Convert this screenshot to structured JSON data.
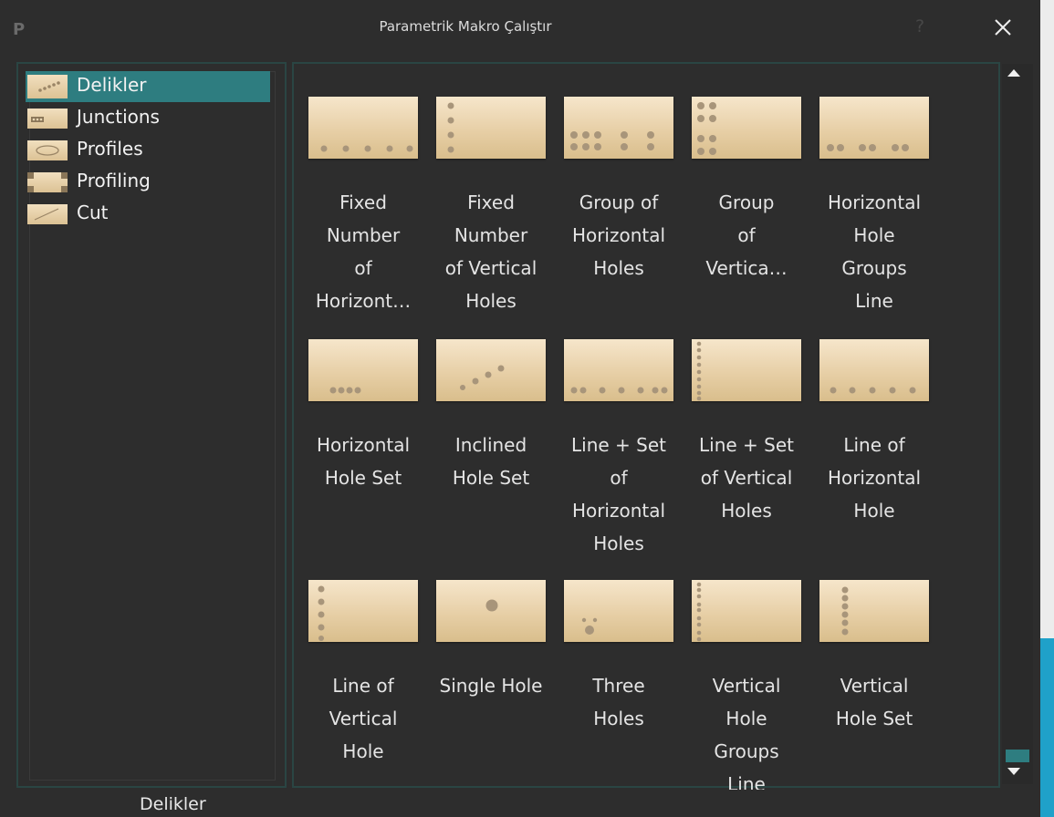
{
  "window": {
    "title": "Parametrik Makro Çalıştır",
    "app_icon": "P",
    "help_label": "?",
    "close_icon": "close-icon"
  },
  "categories": [
    {
      "label": "Delikler",
      "icon": "holes-thumbnail",
      "selected": true
    },
    {
      "label": "Junctions",
      "icon": "junctions-thumbnail",
      "selected": false
    },
    {
      "label": "Profiles",
      "icon": "profiles-thumbnail",
      "selected": false
    },
    {
      "label": "Profiling",
      "icon": "profiling-thumbnail",
      "selected": false
    },
    {
      "label": "Cut",
      "icon": "cut-thumbnail",
      "selected": false
    }
  ],
  "macros": [
    {
      "label": "Fixed\nNumber\nof\nHorizont…",
      "icon": "fixed-horizontal-holes-thumbnail"
    },
    {
      "label": "Fixed\nNumber\nof Vertical\nHoles",
      "icon": "fixed-vertical-holes-thumbnail"
    },
    {
      "label": "Group of\nHorizontal\nHoles",
      "icon": "group-horizontal-holes-thumbnail"
    },
    {
      "label": "Group\nof\nVertica…",
      "icon": "group-vertical-holes-thumbnail"
    },
    {
      "label": "Horizontal\nHole\nGroups\nLine",
      "icon": "horizontal-hole-groups-line-thumbnail"
    },
    {
      "label": "Horizontal\nHole Set",
      "icon": "horizontal-hole-set-thumbnail"
    },
    {
      "label": "Inclined\nHole Set",
      "icon": "inclined-hole-set-thumbnail"
    },
    {
      "label": "Line + Set\nof\nHorizontal\nHoles",
      "icon": "line-set-horizontal-holes-thumbnail"
    },
    {
      "label": "Line + Set\nof Vertical\nHoles",
      "icon": "line-set-vertical-holes-thumbnail"
    },
    {
      "label": "Line of\nHorizontal\nHole",
      "icon": "line-horizontal-hole-thumbnail"
    },
    {
      "label": "Line of\nVertical\nHole",
      "icon": "line-vertical-hole-thumbnail"
    },
    {
      "label": "Single Hole",
      "icon": "single-hole-thumbnail"
    },
    {
      "label": "Three\nHoles",
      "icon": "three-holes-thumbnail"
    },
    {
      "label": "Vertical\nHole\nGroups\nLine",
      "icon": "vertical-hole-groups-line-thumbnail"
    },
    {
      "label": "Vertical\nHole Set",
      "icon": "vertical-hole-set-thumbnail"
    }
  ],
  "status": {
    "text": "Delikler"
  },
  "colors": {
    "background": "#2d2d2d",
    "selection": "#2e7d80",
    "panel_border": "#2a4543",
    "text": "#e4e4e4",
    "accent": "#1fa1c9"
  }
}
